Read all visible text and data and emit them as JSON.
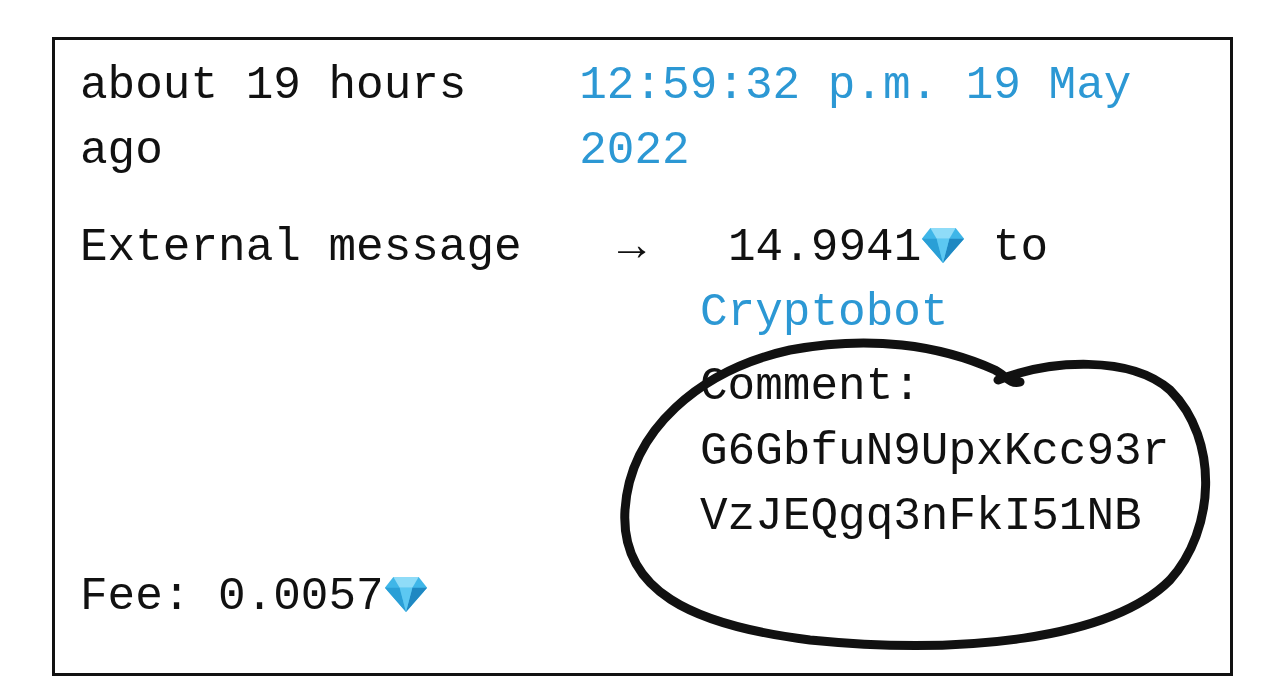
{
  "transaction": {
    "time_ago": "about 19 hours ago",
    "timestamp": "12:59:32 p.m. 19 May 2022",
    "source": "External message",
    "arrow": "→",
    "amount": "14.9941",
    "direction_word": "to",
    "recipient": "Cryptobot",
    "comment_label": "Comment:",
    "comment": "G6GbfuN9UpxKcc93rVzJEQgq3nFkI51NB",
    "fee_label": "Fee:",
    "fee": "0.0057"
  },
  "annotation": {
    "kind": "circle"
  }
}
